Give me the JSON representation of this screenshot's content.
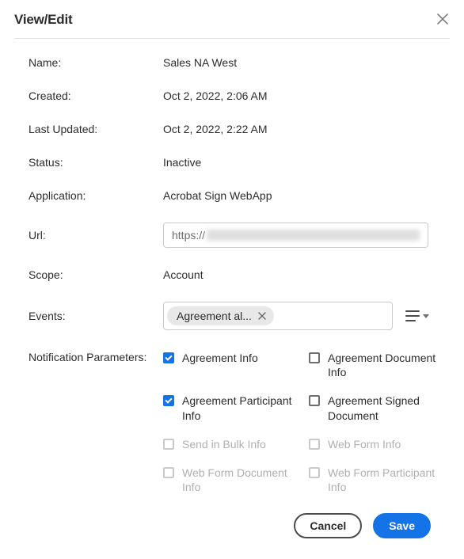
{
  "dialog": {
    "title": "View/Edit"
  },
  "fields": {
    "name": {
      "label": "Name:",
      "value": "Sales NA West"
    },
    "created": {
      "label": "Created:",
      "value": "Oct 2, 2022, 2:06 AM"
    },
    "lastUpdated": {
      "label": "Last Updated:",
      "value": "Oct 2, 2022, 2:22 AM"
    },
    "status": {
      "label": "Status:",
      "value": "Inactive"
    },
    "application": {
      "label": "Application:",
      "value": "Acrobat Sign WebApp"
    },
    "url": {
      "label": "Url:",
      "prefix": "https://"
    },
    "scope": {
      "label": "Scope:",
      "value": "Account"
    },
    "events": {
      "label": "Events:",
      "tag": "Agreement al..."
    },
    "notificationParams": {
      "label": "Notification Parameters:",
      "items": {
        "agreementInfo": "Agreement Info",
        "agreementDocInfo": "Agreement Document Info",
        "agreementParticipantInfo": "Agreement Participant Info",
        "agreementSignedDoc": "Agreement Signed Document",
        "sendInBulkInfo": "Send in Bulk Info",
        "webFormInfo": "Web Form Info",
        "webFormDocInfo": "Web Form Document Info",
        "webFormParticipantInfo": "Web Form Participant Info"
      }
    }
  },
  "buttons": {
    "cancel": "Cancel",
    "save": "Save"
  }
}
